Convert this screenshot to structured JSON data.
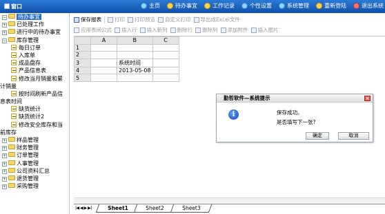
{
  "brand": {
    "title": "窗口"
  },
  "topnav": [
    {
      "label": "主页",
      "icon": "home-icon"
    },
    {
      "label": "待办事宜",
      "icon": "todo-icon"
    },
    {
      "label": "工作记录",
      "icon": "worklog-icon"
    },
    {
      "label": "个性设置",
      "icon": "settings-icon"
    },
    {
      "label": "系统管理",
      "icon": "system-icon"
    },
    {
      "label": "重新登陆",
      "icon": "relogin-icon"
    },
    {
      "label": "退出系统",
      "icon": "exit-icon"
    }
  ],
  "sidebar": {
    "items": [
      {
        "label": "待办事宜",
        "selected": true
      },
      {
        "label": "已处理工作"
      },
      {
        "label": "进行中的待办事宜"
      },
      {
        "label": "库存管理"
      },
      {
        "label": "每日订单"
      },
      {
        "label": "入库单"
      },
      {
        "label": "成品盘存"
      },
      {
        "label": "产品信息表"
      },
      {
        "label": "修改当月销量和累"
      },
      {
        "label": "计销量"
      },
      {
        "label": "按时间刷新产品信"
      },
      {
        "label": "息表时间"
      },
      {
        "label": "缺货统计"
      },
      {
        "label": "缺货统计2"
      },
      {
        "label": "修改安全库存和当"
      },
      {
        "label": "前库存"
      },
      {
        "label": "样品管理"
      },
      {
        "label": "财务管理"
      },
      {
        "label": "订单管理"
      },
      {
        "label": "人事管理"
      },
      {
        "label": "公司资料汇总"
      },
      {
        "label": "退货管理"
      },
      {
        "label": "采购管理"
      }
    ]
  },
  "toolbar": {
    "row1": [
      {
        "label": "保存报表",
        "enabled": true
      },
      {
        "label": "打印",
        "enabled": false
      },
      {
        "label": "打印预览",
        "enabled": false
      },
      {
        "label": "自定义打印",
        "enabled": false
      },
      {
        "label": "导出成Excel文件",
        "enabled": false
      }
    ],
    "row2": [
      {
        "label": "应用表间公式",
        "enabled": false
      },
      {
        "label": "插入行",
        "enabled": false
      },
      {
        "label": "插入新列",
        "enabled": false
      },
      {
        "label": "删除行",
        "enabled": false
      },
      {
        "label": "删除列",
        "enabled": false
      },
      {
        "label": "添加附件",
        "enabled": false
      },
      {
        "label": "插入图片",
        "enabled": false
      }
    ]
  },
  "sheet": {
    "columns": [
      "A",
      "B",
      "C"
    ],
    "rows": [
      {
        "num": "1",
        "cells": [
          "",
          "",
          ""
        ]
      },
      {
        "num": "2",
        "cells": [
          "",
          "",
          ""
        ]
      },
      {
        "num": "3",
        "cells": [
          "",
          "系统时间",
          ""
        ]
      },
      {
        "num": "4",
        "cells": [
          "",
          "2013-05-08",
          ""
        ]
      },
      {
        "num": "5",
        "cells": [
          "",
          "",
          ""
        ]
      }
    ],
    "tabs": [
      "Sheet1",
      "Sheet2",
      "Sheet3"
    ],
    "tab_nav": "|◀ ◀ ▶ ▶|"
  },
  "dialog": {
    "title": "勤哲软件—系统提示",
    "message1": "保存成功。",
    "message2": "是否填写下一张?",
    "ok_label": "确定",
    "cancel_label": "取消",
    "icon_glyph": "i",
    "close_glyph": "×"
  }
}
